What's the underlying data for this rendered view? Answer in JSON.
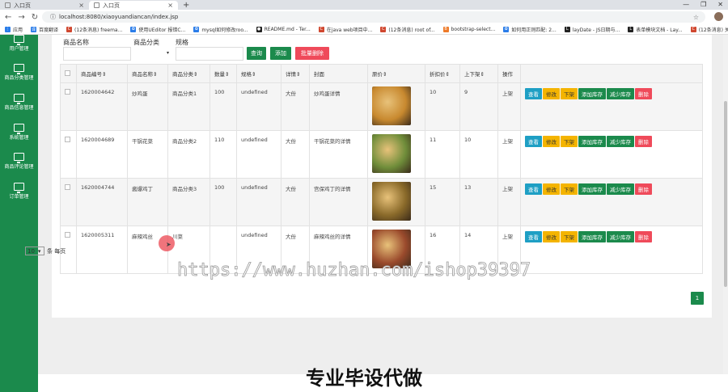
{
  "browser": {
    "tabs": [
      {
        "title": "入口页"
      },
      {
        "title": "入口页"
      }
    ],
    "url": "localhost:8080/xiaoyuandiancan/index.jsp",
    "bookmarks": [
      "应用",
      "百度翻译",
      "(12条消息) freema...",
      "使用UEditor 报错C...",
      "mysql如何修改roo...",
      "README.md - Ter...",
      "在java web项目中...",
      "(12条消息) root of...",
      "bootstrap-select...",
      "如何用正则匹配: 2...",
      "layDate - JS日期与...",
      "表单模块文档 - Lay...",
      "(12条消息) 关于lay..."
    ]
  },
  "sidebar": {
    "items": [
      {
        "label": "用户管理"
      },
      {
        "label": "商品分类管理"
      },
      {
        "label": "商品信息管理"
      },
      {
        "label": "系统管理"
      },
      {
        "label": "商品评论管理"
      },
      {
        "label": "订单管理"
      }
    ]
  },
  "filters": {
    "name_label": "商品名称",
    "category_label": "商品分类",
    "spec_label": "规格",
    "query_button": "查询",
    "add_button": "添加",
    "batch_delete_button": "批量删除"
  },
  "table": {
    "headers": [
      "商品编号⇕",
      "商品名称⇕",
      "商品分类⇕",
      "数量⇕",
      "规格⇕",
      "详情⇕",
      "封面",
      "原价⇕",
      "折扣价⇕",
      "上下架⇕",
      "操作"
    ],
    "rows": [
      {
        "id": "1620004642",
        "name": "炒鸡蛋",
        "category": "商品分类1",
        "qty": "100",
        "spec": "undefined",
        "detail": "大份",
        "desc": "炒鸡蛋详情",
        "price": "10",
        "discount": "9",
        "status": "上架",
        "img": "#c8892f"
      },
      {
        "id": "1620004689",
        "name": "干锅花菜",
        "category": "商品分类2",
        "qty": "110",
        "spec": "undefined",
        "detail": "大份",
        "desc": "干锅花菜的详情",
        "price": "11",
        "discount": "10",
        "status": "上架",
        "img": "#6f8d3a"
      },
      {
        "id": "1620004744",
        "name": "酱爆鸡丁",
        "category": "商品分类3",
        "qty": "100",
        "spec": "undefined",
        "detail": "大份",
        "desc": "宫保鸡丁的详情",
        "price": "15",
        "discount": "13",
        "status": "上架",
        "img": "#8a6a2a"
      },
      {
        "id": "1620005311",
        "name": "麻辣鸡丝",
        "category": "川菜",
        "qty": "",
        "spec": "undefined",
        "detail": "大份",
        "desc": "麻辣鸡丝的详情",
        "price": "16",
        "discount": "14",
        "status": "上架",
        "img": "#9a4a2c"
      }
    ],
    "actions": {
      "view": "查看",
      "edit": "修改",
      "off_shelf": "下架",
      "add_stock": "添加库存",
      "reduce_stock": "减少库存",
      "delete": "删除"
    }
  },
  "pager": {
    "page_size": "10",
    "per_page_label": "条 每页",
    "current_page": "1"
  },
  "overlay": {
    "watermark": "https://www.huzhan.com/ishop39397",
    "ad_text": "专业毕设代做"
  },
  "colors": {
    "brand_green": "#1b8a4c",
    "info_blue": "#1e9fc4",
    "warn_yellow": "#f4b400",
    "danger_red": "#ef4a5a"
  }
}
